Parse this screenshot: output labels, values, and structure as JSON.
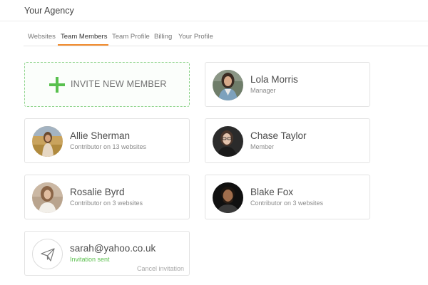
{
  "app": {
    "title": "Your Agency"
  },
  "tabs": [
    {
      "label": "Websites",
      "active": false
    },
    {
      "label": "Team Members",
      "active": true
    },
    {
      "label": "Team Profile",
      "active": false
    },
    {
      "label": "Billing",
      "active": false
    },
    {
      "label": "Your Profile",
      "active": false
    }
  ],
  "colors": {
    "accent": "#f08a2c",
    "invite_green": "#58c04e",
    "dashed_border": "#8fd48c"
  },
  "invite_card": {
    "label": "INVITE NEW MEMBER",
    "icon": "plus-icon"
  },
  "members": [
    {
      "name": "Lola Morris",
      "role": "Manager",
      "avatar": "avatar-lola-morris"
    },
    {
      "name": "Allie Sherman",
      "role": "Contributor on 13 websites",
      "avatar": "avatar-allie-sherman"
    },
    {
      "name": "Chase Taylor",
      "role": "Member",
      "avatar": "avatar-chase-taylor"
    },
    {
      "name": "Rosalie Byrd",
      "role": "Contributor on 3 websites",
      "avatar": "avatar-rosalie-byrd"
    },
    {
      "name": "Blake Fox",
      "role": "Contributor on 3 websites",
      "avatar": "avatar-blake-fox"
    }
  ],
  "pending_invite": {
    "email": "sarah@yahoo.co.uk",
    "status": "Invitation sent",
    "cancel_label": "Cancel invitation",
    "icon": "paper-plane-icon"
  }
}
